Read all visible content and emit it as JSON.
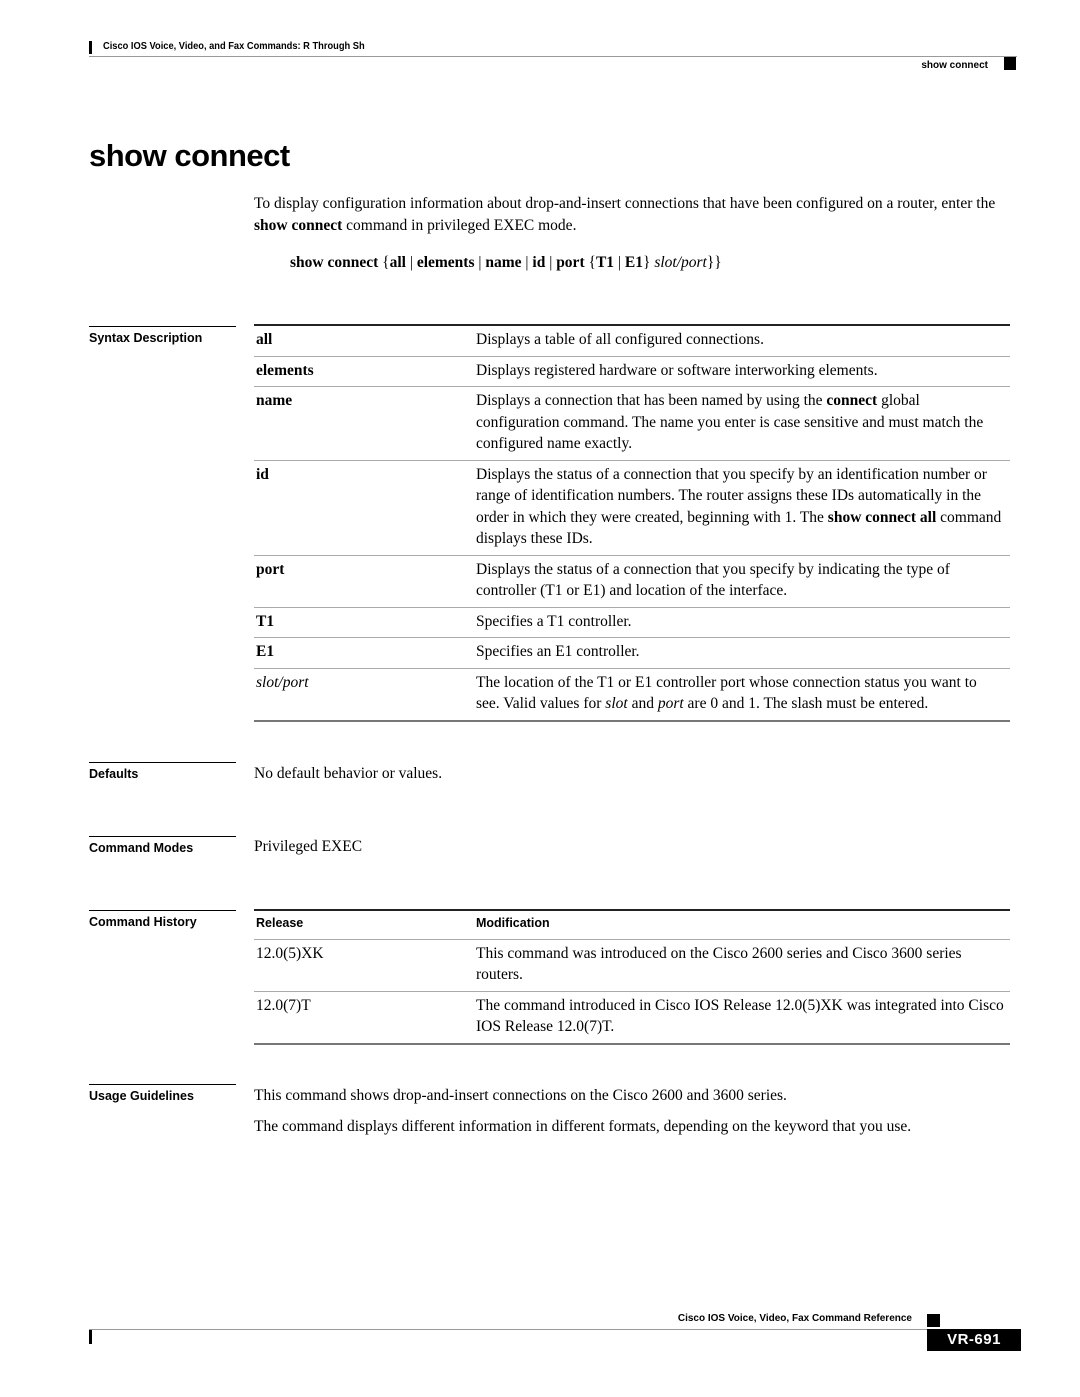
{
  "header": {
    "book_title": "Cisco IOS Voice, Video, and Fax Commands: R Through Sh",
    "running_title": "show connect"
  },
  "page_title": "show connect",
  "intro": {
    "part1": "To display configuration information about drop-and-insert connections that have been configured on a router, enter the ",
    "command": "show connect",
    "part2": " command in privileged EXEC mode."
  },
  "syntax": {
    "cmd": "show connect",
    "open_brace": "{",
    "k_all": "all",
    "k_elements": "elements",
    "k_name": "name",
    "k_id": "id",
    "k_port": "port",
    "inner_open": "{",
    "k_t1": "T1",
    "k_e1": "E1",
    "inner_close": "}",
    "arg": "slot/port",
    "close_brace": "}}",
    "sep": " | "
  },
  "sections": {
    "syntax_description": "Syntax Description",
    "defaults": "Defaults",
    "command_modes": "Command Modes",
    "command_history": "Command History",
    "usage_guidelines": "Usage Guidelines"
  },
  "syntax_table": [
    {
      "keyword": "all",
      "style": "bold",
      "desc": [
        {
          "t": "Displays a table of all configured connections."
        }
      ]
    },
    {
      "keyword": "elements",
      "style": "bold",
      "desc": [
        {
          "t": "Displays registered hardware or software interworking elements."
        }
      ]
    },
    {
      "keyword": "name",
      "style": "bold",
      "desc": [
        {
          "t": "Displays a connection that has been named by using the "
        },
        {
          "t": "connect",
          "b": true
        },
        {
          "t": " global configuration command. The name you enter is case sensitive and must match the configured name exactly."
        }
      ]
    },
    {
      "keyword": "id",
      "style": "bold",
      "desc": [
        {
          "t": "Displays the status of a connection that you specify by an identification number or range of identification numbers. The router assigns these IDs automatically in the order in which they were created, beginning with 1. The "
        },
        {
          "t": "show connect all",
          "b": true
        },
        {
          "t": " command displays these IDs."
        }
      ]
    },
    {
      "keyword": "port",
      "style": "bold",
      "desc": [
        {
          "t": "Displays the status of a connection that you specify by indicating the type of controller (T1 or E1) and location of the interface."
        }
      ]
    },
    {
      "keyword": "T1",
      "style": "bold",
      "desc": [
        {
          "t": "Specifies a T1 controller."
        }
      ]
    },
    {
      "keyword": "E1",
      "style": "bold",
      "desc": [
        {
          "t": "Specifies an E1 controller."
        }
      ]
    },
    {
      "keyword": "slot/port",
      "style": "italic",
      "desc": [
        {
          "t": "The location of the T1 or E1 controller port whose connection status you want to see. Valid values for "
        },
        {
          "t": "slot",
          "i": true
        },
        {
          "t": " and "
        },
        {
          "t": "port",
          "i": true
        },
        {
          "t": " are 0 and 1. The slash must be entered."
        }
      ]
    }
  ],
  "defaults": "No default behavior or values.",
  "command_modes": "Privileged EXEC",
  "history": {
    "headers": [
      "Release",
      "Modification"
    ],
    "rows": [
      {
        "release": "12.0(5)XK",
        "modification": "This command was introduced on the Cisco 2600 series and Cisco 3600 series routers."
      },
      {
        "release": "12.0(7)T",
        "modification": "The command introduced in Cisco IOS Release 12.0(5)XK was integrated into Cisco IOS Release 12.0(7)T."
      }
    ]
  },
  "usage": [
    "This command shows drop-and-insert connections on the Cisco 2600 and 3600 series.",
    "The command displays different information in different formats, depending on the keyword that you use."
  ],
  "footer": {
    "book_title": "Cisco IOS Voice, Video, Fax Command Reference",
    "page_number": "VR-691"
  }
}
